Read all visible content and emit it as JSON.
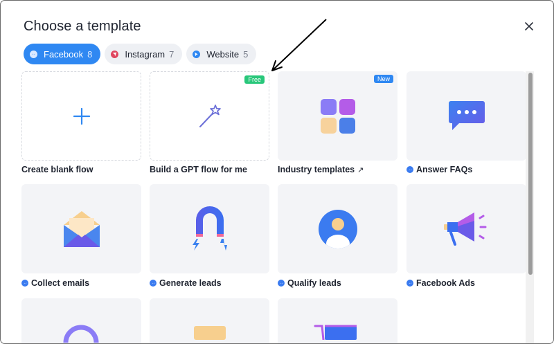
{
  "dialog": {
    "title": "Choose a template"
  },
  "tabs": [
    {
      "label": "Facebook",
      "count": "8",
      "active": true
    },
    {
      "label": "Instagram",
      "count": "7",
      "active": false
    },
    {
      "label": "Website",
      "count": "5",
      "active": false
    }
  ],
  "cards": [
    {
      "label": "Create blank flow",
      "icon": "plus-icon"
    },
    {
      "label": "Build a GPT flow for me",
      "icon": "magic-wand-icon",
      "badge": "Free"
    },
    {
      "label": "Industry templates",
      "icon": "grid-icon",
      "badge": "New",
      "external": "↗"
    },
    {
      "label": "Answer FAQs",
      "icon": "chat-bubble-icon"
    },
    {
      "label": "Collect emails",
      "icon": "envelope-icon"
    },
    {
      "label": "Generate leads",
      "icon": "magnet-icon"
    },
    {
      "label": "Qualify leads",
      "icon": "user-avatar-icon"
    },
    {
      "label": "Facebook Ads",
      "icon": "megaphone-icon"
    }
  ],
  "colors": {
    "accent": "#2f88f2",
    "free_badge": "#28c77a",
    "messenger": "#3a7bf0",
    "card_bg": "#f3f4f7"
  }
}
